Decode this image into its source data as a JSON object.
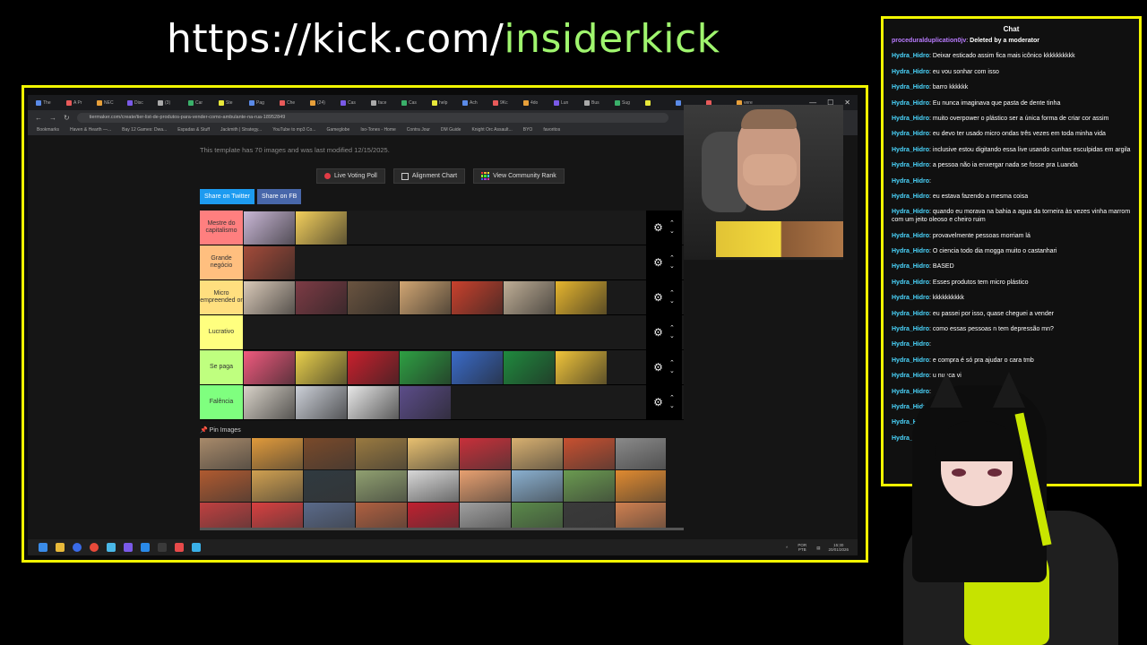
{
  "banner": {
    "prefix": "https://kick.com/",
    "highlight": "insiderkick"
  },
  "browser": {
    "tabs": [
      "The",
      "A Pr",
      "NEC",
      "Disc",
      "(3)",
      "Car",
      "Ste",
      "Pag",
      "Che",
      "(24)",
      "Cas",
      "face",
      "Cas",
      "help",
      "Ach",
      "9Kc",
      "4do",
      "Lun",
      "Bus",
      "Sug",
      "",
      "",
      "",
      "vere"
    ],
    "url": "tiermaker.com/create/tier-list-de-produtos-para-vender-como-ambulante-na-rua-18952849",
    "bookmarks": [
      "Bookmarks",
      "Haven & Hearth —...",
      "Bay 12 Games: Dwa...",
      "Espadas & Stuff",
      "Jackmith | Strategy...",
      "YouTube to mp3 Co...",
      "Gameglobe",
      "Iso-Tones - Home",
      "Contra Jour",
      "DM Guide",
      "Knight Orc Assault...",
      "BYO",
      "favoritos"
    ]
  },
  "page": {
    "template_info": "This template has 70 images and was last modified 12/15/2025.",
    "buttons": {
      "live_poll": "Live Voting Poll",
      "alignment": "Alignment Chart",
      "community": "View Community Rank"
    },
    "share": {
      "twitter": "Share on Twitter",
      "fb": "Share on FB"
    },
    "pin_label": "Pin Images"
  },
  "tiers": [
    {
      "label": "Mestre do capitalismo",
      "color": "#ff7f7f",
      "items": [
        "#c9b7d6",
        "#f3cf5c"
      ]
    },
    {
      "label": "Grande negócio",
      "color": "#ffbf7f",
      "items": [
        "#a34b3a"
      ]
    },
    {
      "label": "Micro empreended or",
      "color": "#ffdf7f",
      "items": [
        "#d9c9b8",
        "#7d3b45",
        "#6a5440",
        "#d1a673",
        "#c9412d",
        "#bfae96",
        "#e6b52e"
      ]
    },
    {
      "label": "Lucrativo",
      "color": "#ffff7f",
      "items": []
    },
    {
      "label": "Se paga",
      "color": "#bfff7f",
      "items": [
        "#f05a7e",
        "#e9d04b",
        "#c9202d",
        "#2ea043",
        "#3a6bc9",
        "#1f8a3e",
        "#f0c43a"
      ]
    },
    {
      "label": "Falência",
      "color": "#7fff7f",
      "items": [
        "#d8d2c8",
        "#ccd0d8",
        "#e8e8e8",
        "#5c4d8a"
      ]
    }
  ],
  "pin_images": [
    "#a88a6a",
    "#e09a3b",
    "#7a4a2a",
    "#9a7a40",
    "#e8c070",
    "#c8303a",
    "#d8b070",
    "#c85030",
    "#8a8a8a",
    "#b05a30",
    "#d0a050",
    "#303a40",
    "#90a070",
    "#d8d8d8",
    "#e8a070",
    "#8ab0d0",
    "#6a9a50",
    "#e08a30",
    "#c04040",
    "#d84040",
    "#5a6a8a",
    "#b06040",
    "#c02030",
    "#a0a0a0",
    "#5a8a4a",
    "#3a3a3a",
    "#d08050"
  ],
  "taskbar": {
    "lang": "POR PTB",
    "time": "15:30",
    "date": "20/01/2026"
  },
  "chat": {
    "title": "Chat",
    "messages": [
      {
        "user": "proceduralduplication0jv",
        "text": "Deleted by a moderator",
        "alt": true
      },
      {
        "user": "Hydra_Hidro",
        "text": "Deixar esticado assim fica mais icônico kkkkkkkkkk"
      },
      {
        "user": "Hydra_Hidro",
        "text": "eu vou sonhar com isso"
      },
      {
        "user": "Hydra_Hidro",
        "text": "barro kkkkkk"
      },
      {
        "user": "Hydra_Hidro",
        "text": "Eu nunca imaginava que pasta de dente tinha"
      },
      {
        "user": "Hydra_Hidro",
        "text": "muito overpower o plástico ser a única forma de criar cor assim"
      },
      {
        "user": "Hydra_Hidro",
        "text": "eu devo ter usado micro ondas três vezes em toda minha vida"
      },
      {
        "user": "Hydra_Hidro",
        "text": "inclusive estou digitando essa live usando cunhas esculpidas em argila"
      },
      {
        "user": "Hydra_Hidro",
        "text": "a pessoa não ia enxergar nada se fosse pra Luanda"
      },
      {
        "user": "Hydra_Hidro",
        "text": ""
      },
      {
        "user": "Hydra_Hidro",
        "text": "eu estava fazendo a mesma coisa"
      },
      {
        "user": "Hydra_Hidro",
        "text": "quando eu morava na bahia a agua da torneira às vezes vinha marrom com um jeito oleoso e cheiro ruim"
      },
      {
        "user": "Hydra_Hidro",
        "text": "provavelmente pessoas morriam lá"
      },
      {
        "user": "Hydra_Hidro",
        "text": "O ciencia todo dia mogga muito o castanhari"
      },
      {
        "user": "Hydra_Hidro",
        "text": "BASED"
      },
      {
        "user": "Hydra_Hidro",
        "text": "Esses produtos tem micro plástico"
      },
      {
        "user": "Hydra_Hidro",
        "text": "kkkkkkkkkk"
      },
      {
        "user": "Hydra_Hidro",
        "text": "eu passei por isso, quase cheguei a vender"
      },
      {
        "user": "Hydra_Hidro",
        "text": "como essas pessoas n tem depressão mn?"
      },
      {
        "user": "Hydra_Hidro",
        "text": ""
      },
      {
        "user": "Hydra_Hidro",
        "text": "e compra é só pra ajudar o cara tmb"
      },
      {
        "user": "Hydra_Hidro",
        "text": "u nunca vi"
      },
      {
        "user": "Hydra_Hidro",
        "text": ""
      },
      {
        "user": "Hydra_Hidro",
        "text": ""
      },
      {
        "user": "Hydra_Hidro",
        "text": ""
      },
      {
        "user": "Hydra_Hidro",
        "text": ""
      }
    ]
  },
  "colors": {
    "frame": "#f2f600",
    "banner_highlight": "#9ff56e",
    "chat_user": "#4bd7ff"
  }
}
